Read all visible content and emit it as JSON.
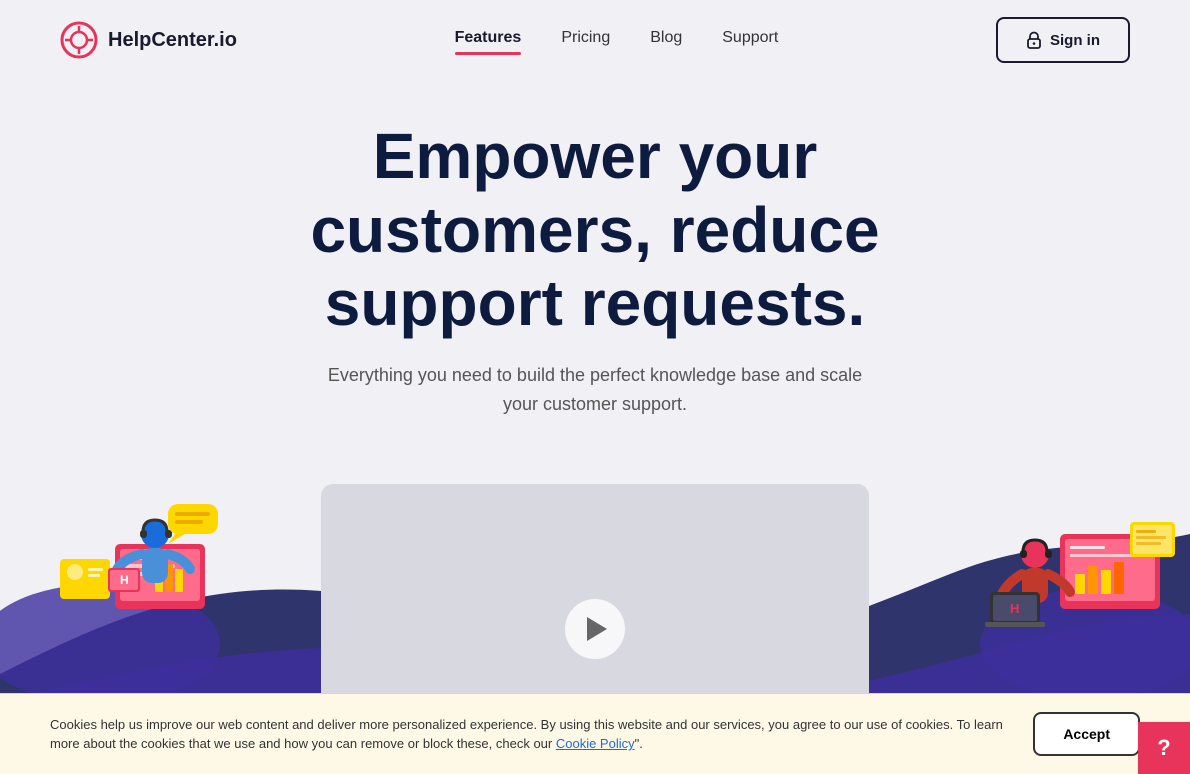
{
  "nav": {
    "logo_text": "HelpCenter.io",
    "links": [
      {
        "label": "Features",
        "active": true
      },
      {
        "label": "Pricing",
        "active": false
      },
      {
        "label": "Blog",
        "active": false
      },
      {
        "label": "Support",
        "active": false
      }
    ],
    "signin_label": "Sign in"
  },
  "hero": {
    "title": "Empower your customers, reduce support requests.",
    "subtitle": "Everything you need to build the perfect knowledge base and scale your customer support."
  },
  "cookie": {
    "text": "Cookies help us improve our web content and deliver more personalized experience. By using this website and our services, you agree to our use of cookies. To learn more about the cookies that we use and how you can remove or block these, check our ",
    "link_text": "Cookie Policy",
    "text_end": "\".",
    "accept_label": "Accept"
  },
  "revain": {
    "label": "?"
  },
  "colors": {
    "accent_red": "#e8345a",
    "navy": "#0d1b3e",
    "purple_wave": "#4b3ca7",
    "bright_purple": "#6c5ce7"
  }
}
